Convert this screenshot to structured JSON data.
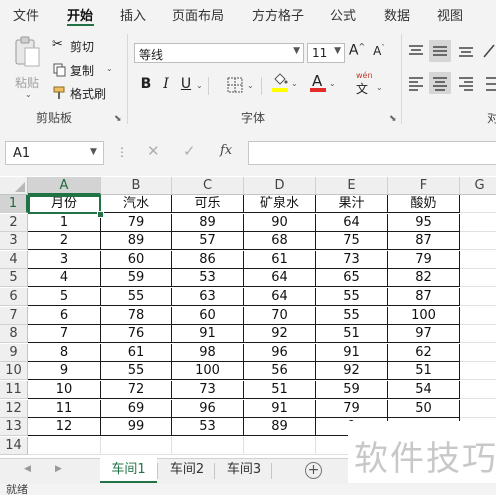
{
  "menu": {
    "tabs": [
      "文件",
      "开始",
      "插入",
      "页面布局",
      "方方格子",
      "公式",
      "数据",
      "视图"
    ],
    "active": "开始"
  },
  "ribbon": {
    "paste_label": "粘贴",
    "cut_label": "剪切",
    "copy_label": "复制",
    "format_painter_label": "格式刷",
    "clipboard_group": "剪贴板",
    "font_name": "等线",
    "font_size": "11",
    "font_group": "字体",
    "alignment_group_partial": "对",
    "bold": "B",
    "italic": "I",
    "underline": "U",
    "grow_font": "A",
    "shrink_font": "A",
    "font_color_letter": "A",
    "phonetic_label": "wén",
    "phonetic_char": "文",
    "colors": {
      "highlight": "#ffff00",
      "font_color": "#e32b2b",
      "accent": "#217346"
    }
  },
  "formula_bar": {
    "name_box": "A1",
    "fx_label": "fx",
    "formula": ""
  },
  "sheet": {
    "columns": [
      "A",
      "B",
      "C",
      "D",
      "E",
      "F",
      "G"
    ],
    "rows": [
      "1",
      "2",
      "3",
      "4",
      "5",
      "6",
      "7",
      "8",
      "9",
      "10",
      "11",
      "12",
      "13",
      "14"
    ],
    "header_row": [
      "月份",
      "汽水",
      "可乐",
      "矿泉水",
      "果汁",
      "酸奶"
    ],
    "data": [
      [
        "1",
        "79",
        "89",
        "90",
        "64",
        "95"
      ],
      [
        "2",
        "89",
        "57",
        "68",
        "75",
        "87"
      ],
      [
        "3",
        "60",
        "86",
        "61",
        "73",
        "79"
      ],
      [
        "4",
        "59",
        "53",
        "64",
        "65",
        "82"
      ],
      [
        "5",
        "55",
        "63",
        "64",
        "55",
        "87"
      ],
      [
        "6",
        "78",
        "60",
        "70",
        "55",
        "100"
      ],
      [
        "7",
        "76",
        "91",
        "92",
        "51",
        "97"
      ],
      [
        "8",
        "61",
        "98",
        "96",
        "91",
        "62"
      ],
      [
        "9",
        "55",
        "100",
        "56",
        "92",
        "51"
      ],
      [
        "10",
        "72",
        "73",
        "51",
        "59",
        "54"
      ],
      [
        "11",
        "69",
        "96",
        "91",
        "79",
        "50"
      ],
      [
        "12",
        "99",
        "53",
        "89",
        "9",
        ""
      ]
    ]
  },
  "sheet_tabs": {
    "tabs": [
      "车间1",
      "车间2",
      "车间3"
    ],
    "active": "车间1",
    "add_symbol": "+"
  },
  "status_bar": {
    "text": "就绪"
  },
  "watermark": {
    "text": "软件技巧"
  }
}
